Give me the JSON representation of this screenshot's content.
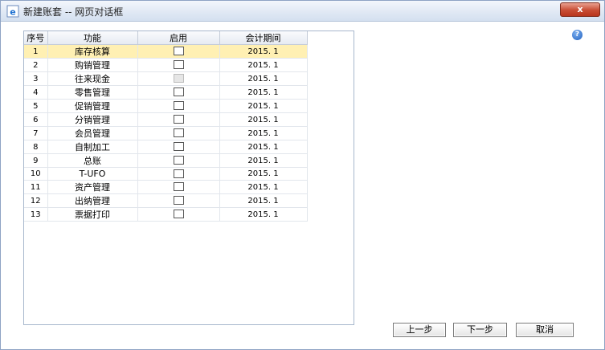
{
  "window": {
    "title": "新建账套 -- 网页对话框",
    "close_label": "x"
  },
  "help_icon": "?",
  "table": {
    "headers": [
      "序号",
      "功能",
      "启用",
      "会计期间"
    ],
    "rows": [
      {
        "no": "1",
        "func": "库存核算",
        "enabled": false,
        "disabled": false,
        "period": "2015. 1",
        "selected": true
      },
      {
        "no": "2",
        "func": "购销管理",
        "enabled": false,
        "disabled": false,
        "period": "2015. 1"
      },
      {
        "no": "3",
        "func": "往来现金",
        "enabled": false,
        "disabled": true,
        "period": "2015. 1"
      },
      {
        "no": "4",
        "func": "零售管理",
        "enabled": false,
        "disabled": false,
        "period": "2015. 1"
      },
      {
        "no": "5",
        "func": "促销管理",
        "enabled": false,
        "disabled": false,
        "period": "2015. 1"
      },
      {
        "no": "6",
        "func": "分销管理",
        "enabled": false,
        "disabled": false,
        "period": "2015. 1"
      },
      {
        "no": "7",
        "func": "会员管理",
        "enabled": false,
        "disabled": false,
        "period": "2015. 1"
      },
      {
        "no": "8",
        "func": "自制加工",
        "enabled": false,
        "disabled": false,
        "period": "2015. 1"
      },
      {
        "no": "9",
        "func": "总账",
        "enabled": false,
        "disabled": false,
        "period": "2015. 1"
      },
      {
        "no": "10",
        "func": "T-UFO",
        "enabled": false,
        "disabled": false,
        "period": "2015. 1"
      },
      {
        "no": "11",
        "func": "资产管理",
        "enabled": false,
        "disabled": false,
        "period": "2015. 1"
      },
      {
        "no": "12",
        "func": "出纳管理",
        "enabled": false,
        "disabled": false,
        "period": "2015. 1"
      },
      {
        "no": "13",
        "func": "票据打印",
        "enabled": false,
        "disabled": false,
        "period": "2015. 1"
      }
    ]
  },
  "buttons": {
    "prev": "上一步",
    "next": "下一步",
    "cancel": "取消"
  }
}
